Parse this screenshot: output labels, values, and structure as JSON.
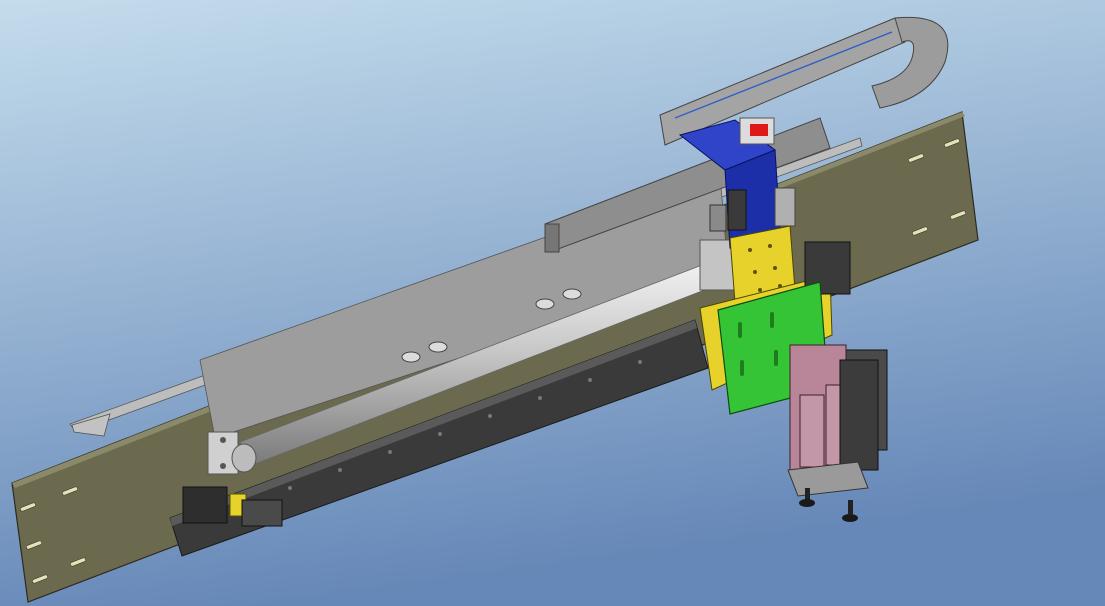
{
  "viewport": {
    "background_top": "#c4dcec",
    "background_bottom": "#6688b8"
  },
  "colors": {
    "base_plate": "#6b6a4e",
    "base_plate_edge": "#2c2b1e",
    "slot": "#e6e2b8",
    "sheet_metal": "#b4b4b4",
    "sheet_metal_dark": "#7c7c7c",
    "rod": "#c6c6c6",
    "rail_dark": "#2e2e2e",
    "rail_mid": "#454545",
    "yellow_accent": "#e6d22a",
    "blue_bracket": "#1c2fa8",
    "green_panel": "#35c435",
    "cylinder_pink": "#b88698",
    "display_red": "#e01818"
  },
  "assembly": {
    "components": [
      "base-plate",
      "top-sheet-metal-guard",
      "cable-chain",
      "guide-rod",
      "linear-rail",
      "yellow-carriage-plate",
      "green-mounting-panel",
      "blue-sensor-bracket",
      "pneumatic-cylinders",
      "vacuum-suction-cups"
    ]
  }
}
